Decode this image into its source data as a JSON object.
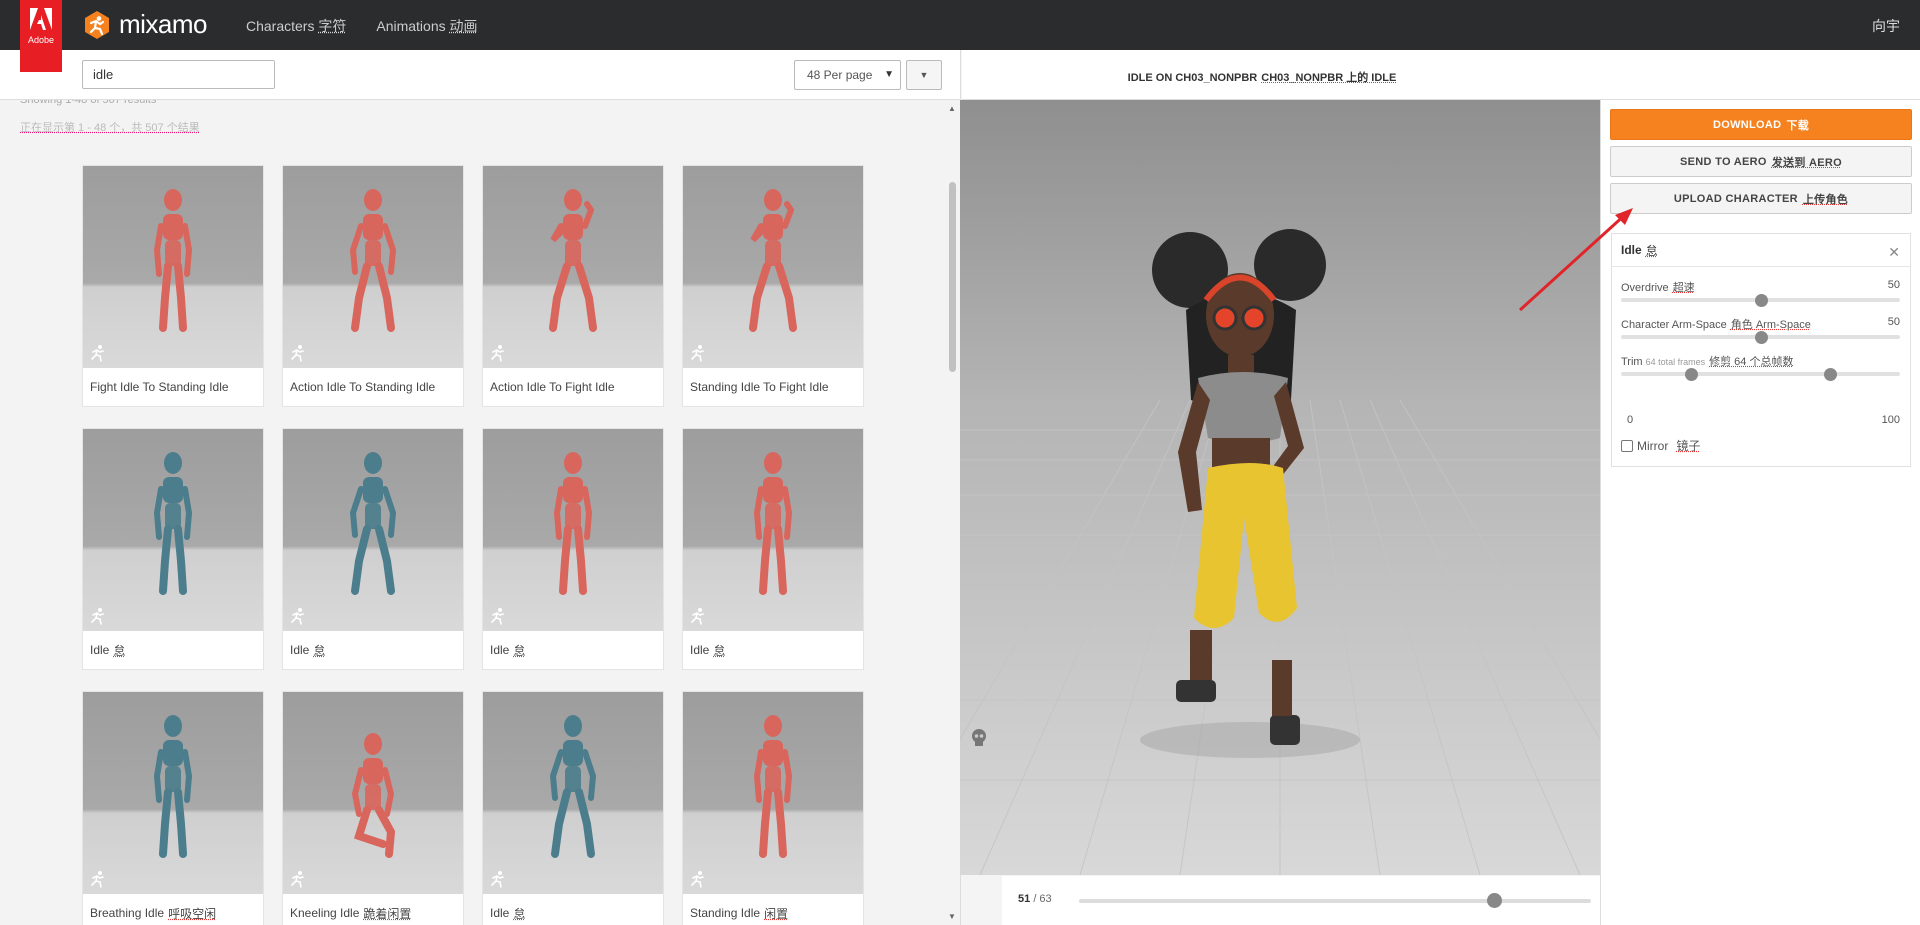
{
  "header": {
    "adobe_label": "Adobe",
    "brand": "mixamo",
    "nav": [
      {
        "en": "Characters",
        "cn": "字符"
      },
      {
        "en": "Animations",
        "cn": "动画"
      }
    ],
    "user": "向宇"
  },
  "search": {
    "value": "idle",
    "per_page": "48 Per page",
    "results_en": "Showing 1-48 of 507 results",
    "results_cn": "正在显示第 1 - 48 个，共 507 个结果"
  },
  "cards": [
    {
      "title": "Fight Idle To Standing Idle",
      "cn": "",
      "color": "red",
      "pose": "stand"
    },
    {
      "title": "Action Idle To Standing Idle",
      "cn": "",
      "color": "red",
      "pose": "wide"
    },
    {
      "title": "Action Idle To Fight Idle",
      "cn": "",
      "color": "red",
      "pose": "fight"
    },
    {
      "title": "Standing Idle To Fight Idle",
      "cn": "",
      "color": "red",
      "pose": "fight"
    },
    {
      "title": "Idle",
      "cn": "怠",
      "color": "blue",
      "pose": "stand"
    },
    {
      "title": "Idle",
      "cn": "怠",
      "color": "blue",
      "pose": "wide"
    },
    {
      "title": "Idle",
      "cn": "怠",
      "color": "red",
      "pose": "stand"
    },
    {
      "title": "Idle",
      "cn": "怠",
      "color": "red",
      "pose": "stand"
    },
    {
      "title": "Breathing Idle",
      "cn": "呼吸空闲",
      "color": "blue",
      "pose": "stand"
    },
    {
      "title": "Kneeling Idle",
      "cn": "跪着闲置",
      "color": "red",
      "pose": "kneel"
    },
    {
      "title": "Idle",
      "cn": "怠",
      "color": "blue",
      "pose": "wide"
    },
    {
      "title": "Standing Idle",
      "cn": "闲置",
      "color": "red",
      "pose": "stand"
    }
  ],
  "viewer": {
    "title_en": "IDLE ON CH03_NONPBR",
    "title_cn": "CH03_NONPBR 上的 IDLE",
    "frame_current": "51",
    "frame_total": "/ 63",
    "timeline_progress": 0.81
  },
  "actions": {
    "download": {
      "en": "DOWNLOAD",
      "cn": "下载"
    },
    "aero": {
      "en": "SEND TO AERO",
      "cn": "发送到 AERO"
    },
    "upload": {
      "en": "UPLOAD CHARACTER",
      "cn": "上传角色"
    }
  },
  "settings": {
    "title": "Idle",
    "title_cn": "怠",
    "overdrive": {
      "label": "Overdrive",
      "cn": "超速",
      "value": "50",
      "fraction": 0.5
    },
    "arm_space": {
      "label": "Character Arm-Space",
      "cn": "角色 Arm-Space",
      "value": "50",
      "fraction": 0.5
    },
    "trim": {
      "label": "Trim",
      "small": "64 total frames",
      "cn": "修剪 64 个总帧数",
      "min": "0",
      "max": "100",
      "low": 0.25,
      "high": 0.75
    },
    "mirror": {
      "label": "Mirror",
      "cn": "镜子",
      "checked": false
    }
  },
  "colors": {
    "accent": "#f5821f",
    "adobe_red": "#e81e25",
    "topbar": "#2b2c2e",
    "mannequin_red": "#d9665d",
    "mannequin_blue": "#4b7d8c",
    "annotation_arrow": "#e0242a"
  }
}
